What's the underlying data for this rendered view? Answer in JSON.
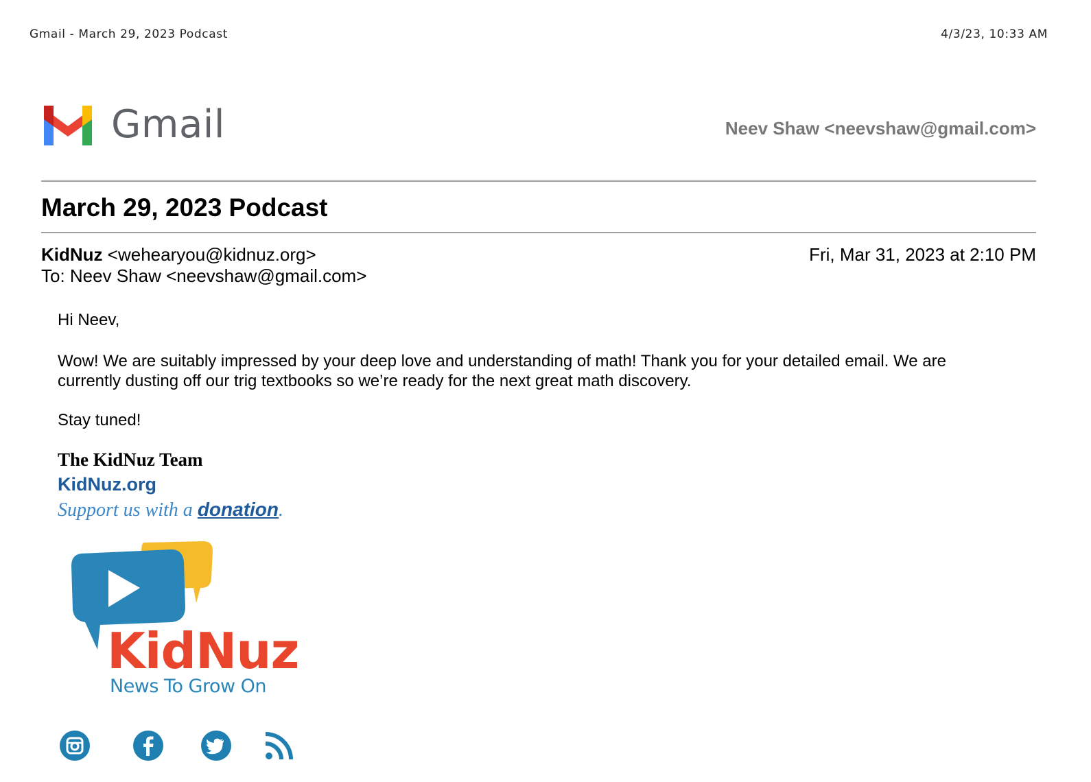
{
  "print_header": {
    "title": "Gmail - March 29, 2023 Podcast",
    "timestamp": "4/3/23, 10:33 AM"
  },
  "brand": {
    "product_name": "Gmail",
    "logo_icon": "gmail-m-icon"
  },
  "account": {
    "label": "Neev Shaw <neevshaw@gmail.com>"
  },
  "email": {
    "subject": "March 29, 2023 Podcast",
    "sender_name": "KidNuz",
    "sender_email": "<wehearyou@kidnuz.org>",
    "date": "Fri, Mar 31, 2023 at 2:10 PM",
    "to": "To: Neev Shaw <neevshaw@gmail.com>",
    "body": {
      "greeting": "Hi Neev,",
      "paragraph": "Wow! We are suitably impressed by your deep love and understanding of math! Thank you for your detailed email. We are currently dusting off our trig textbooks so we’re ready for the next great math discovery.",
      "closing": "Stay tuned!"
    },
    "signature": {
      "team": "The KidNuz Team",
      "website": "KidNuz.org",
      "support_prefix": "Support us with a ",
      "support_link": "donation",
      "support_suffix": "."
    }
  },
  "kidnuz_logo": {
    "name": "KidNuz",
    "tagline": "News To Grow On",
    "colors": {
      "red": "#e8452c",
      "blue": "#2a86b9",
      "yellow": "#f6bb2a"
    }
  },
  "socials": [
    {
      "icon": "instagram-icon"
    },
    {
      "icon": "facebook-icon"
    },
    {
      "icon": "twitter-icon"
    },
    {
      "icon": "rss-icon"
    }
  ],
  "colors": {
    "link": "#1f5a9a",
    "link_light": "#3d87c7",
    "social": "#1f7fb0"
  }
}
